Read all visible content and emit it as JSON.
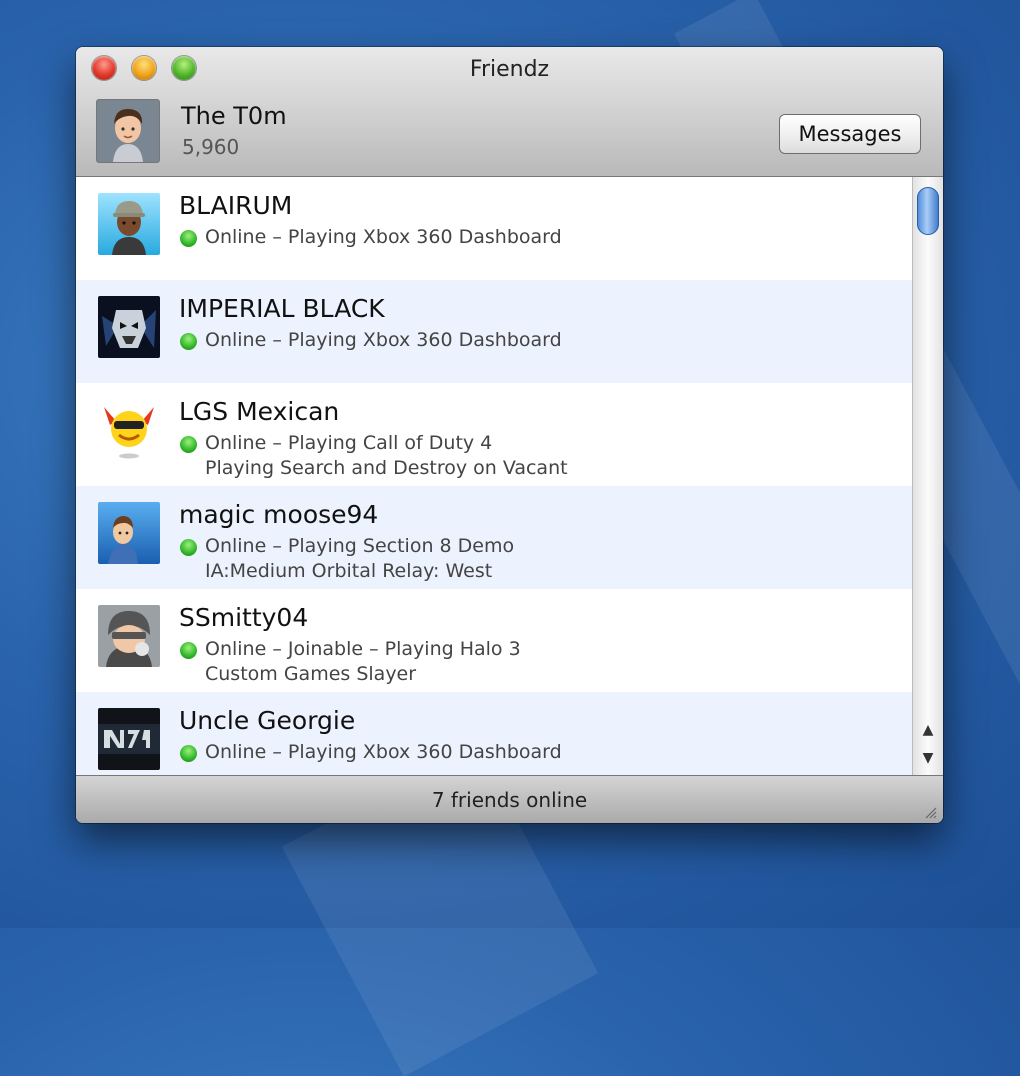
{
  "window": {
    "title": "Friendz"
  },
  "profile": {
    "gamertag": "The T0m",
    "gamerscore": "5,960"
  },
  "header": {
    "messages_label": "Messages"
  },
  "friends": [
    {
      "name": "BLAIRUM",
      "status": "Online – Playing Xbox 360 Dashboard",
      "detail": ""
    },
    {
      "name": "IMPERIAL BLACK",
      "status": "Online – Playing Xbox 360 Dashboard",
      "detail": ""
    },
    {
      "name": "LGS Mexican",
      "status": "Online – Playing Call of Duty 4",
      "detail": "Playing Search and Destroy on Vacant"
    },
    {
      "name": "magic moose94",
      "status": "Online – Playing Section 8 Demo",
      "detail": "IA:Medium Orbital Relay: West"
    },
    {
      "name": "SSmitty04",
      "status": "Online – Joinable – Playing Halo 3",
      "detail": "Custom Games Slayer"
    },
    {
      "name": "Uncle Georgie",
      "status": "Online – Playing Xbox 360 Dashboard",
      "detail": ""
    }
  ],
  "footer": {
    "status_text": "7 friends online"
  },
  "colors": {
    "online": "#2fb52a",
    "alt_row": "#edf3fe",
    "scroll_thumb": "#4a86d8"
  },
  "icons": {
    "close": "close-light-icon",
    "minimize": "minimize-light-icon",
    "zoom": "zoom-light-icon",
    "online": "online-dot-icon",
    "scroll_up": "arrow-up-icon",
    "scroll_down": "arrow-down-icon",
    "resize": "resize-grip-icon"
  }
}
